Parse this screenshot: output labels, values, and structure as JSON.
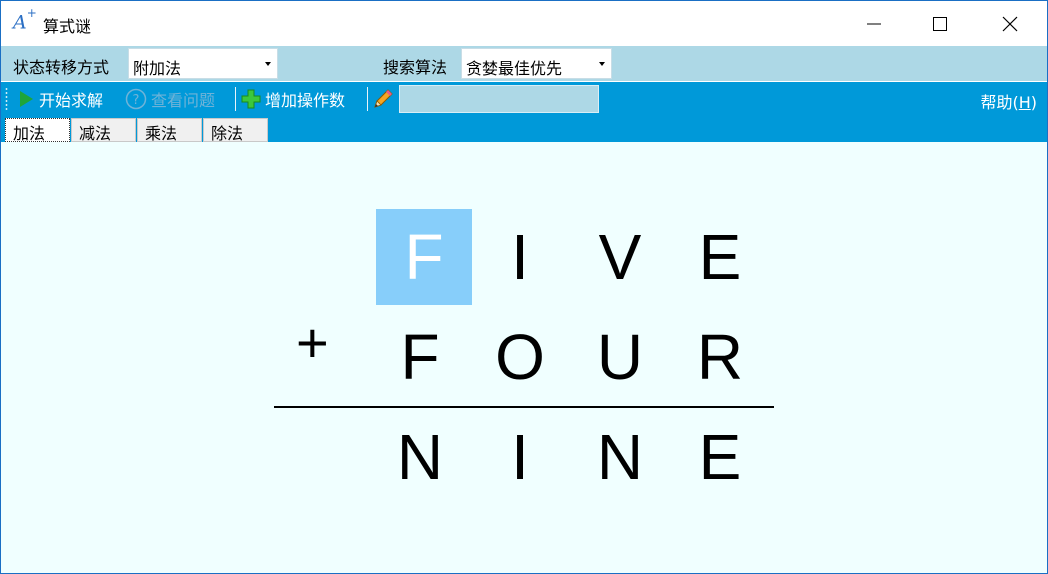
{
  "window": {
    "title": "算式谜",
    "icon_label": "A",
    "icon_sup": "+"
  },
  "options": {
    "transfer_label": "状态转移方式",
    "transfer_value": "附加法",
    "search_label": "搜索算法",
    "search_value": "贪婪最佳优先"
  },
  "toolbar": {
    "start_label": "开始求解",
    "view_label": "查看问题",
    "add_label": "增加操作数",
    "input_value": "",
    "help_text": "帮助(",
    "help_key": "H",
    "help_close": ")"
  },
  "tabs": [
    {
      "label": "加法",
      "active": true
    },
    {
      "label": "减法",
      "active": false
    },
    {
      "label": "乘法",
      "active": false
    },
    {
      "label": "除法",
      "active": false
    }
  ],
  "puzzle": {
    "operator": "+",
    "row1": [
      "F",
      "I",
      "V",
      "E"
    ],
    "row2": [
      "F",
      "O",
      "U",
      "R"
    ],
    "result": [
      "N",
      "I",
      "N",
      "E"
    ],
    "selected_row": 0,
    "selected_col": 0
  },
  "colors": {
    "accent": "#0099d9",
    "option_bar": "#add8e6",
    "selection": "#87cefa",
    "canvas": "#f0ffff"
  }
}
